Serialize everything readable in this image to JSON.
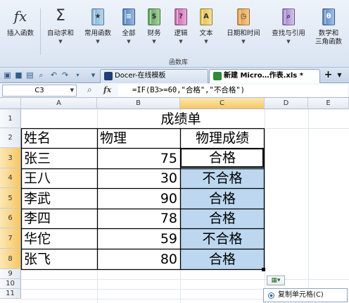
{
  "ribbon": {
    "buttons": [
      {
        "label": "插入函数",
        "icon": "fx-icon",
        "glyph": "fx"
      },
      {
        "label": "自动求和",
        "icon": "sigma-icon",
        "glyph": "Σ"
      },
      {
        "label": "常用函数",
        "icon": "book-star-icon",
        "glyph": "★"
      },
      {
        "label": "全部",
        "icon": "book-blue-icon",
        "glyph": "≡"
      },
      {
        "label": "财务",
        "icon": "book-money-icon",
        "glyph": "$"
      },
      {
        "label": "逻辑",
        "icon": "book-question-icon",
        "glyph": "?"
      },
      {
        "label": "文本",
        "icon": "book-text-icon",
        "glyph": "A"
      },
      {
        "label": "日期和时间",
        "icon": "book-clock-icon",
        "glyph": "◷"
      },
      {
        "label": "查找与引用",
        "icon": "book-search-icon",
        "glyph": "⌕"
      },
      {
        "label": "数学和",
        "label2": "三角函数",
        "icon": "book-theta-icon",
        "glyph": "θ"
      }
    ],
    "group_label": "函数库"
  },
  "tabs": {
    "docer_label": "Docer-在线模板",
    "file_label": "新建 Micro…作表.xls *",
    "add_label": "+"
  },
  "formula_bar": {
    "name_box": "C3",
    "fx": "fx",
    "formula": "=IF(B3>=60,\"合格\",\"不合格\")"
  },
  "grid": {
    "columns": [
      "A",
      "B",
      "C",
      "D",
      "E"
    ],
    "rows": [
      "1",
      "2",
      "3",
      "4",
      "5",
      "6",
      "7",
      "8",
      "9",
      "10",
      "11"
    ],
    "title": "成绩单",
    "headers": [
      "姓名",
      "物理",
      "物理成绩"
    ],
    "records": [
      {
        "name": "张三",
        "score": "75",
        "result": "合格"
      },
      {
        "name": "王八",
        "score": "30",
        "result": "不合格"
      },
      {
        "name": "李武",
        "score": "90",
        "result": "合格"
      },
      {
        "name": "李四",
        "score": "78",
        "result": "合格"
      },
      {
        "name": "华佗",
        "score": "59",
        "result": "不合格"
      },
      {
        "name": "张飞",
        "score": "80",
        "result": "合格"
      }
    ]
  },
  "paste_options": {
    "menu_item": "复制单元格(C)"
  },
  "colors": {
    "selection": "#bcd7ef",
    "header_selected": "#f6c765",
    "ribbon": "#d9e4f2"
  }
}
